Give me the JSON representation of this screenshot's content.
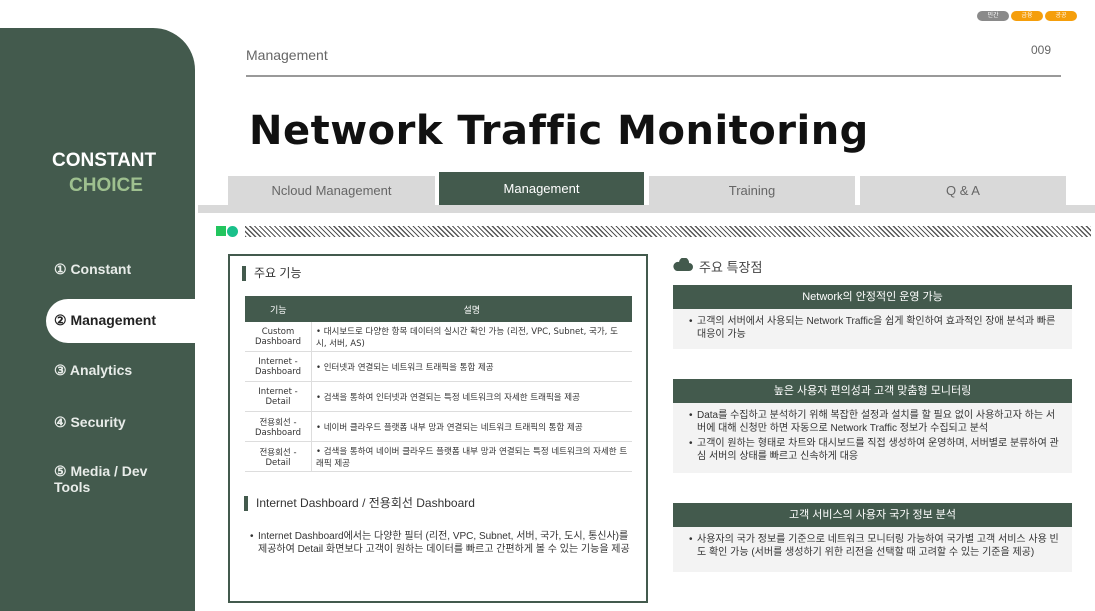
{
  "badges": [
    {
      "label": "민간",
      "color": "#8a8a8a"
    },
    {
      "label": "금융",
      "color": "#f59e0b"
    },
    {
      "label": "공공",
      "color": "#f59e0b"
    }
  ],
  "sidebar": {
    "logo_line1": "CONSTANT",
    "logo_line2": "CHOICE",
    "items": [
      {
        "label": "① Constant"
      },
      {
        "label": "② Management"
      },
      {
        "label": "③ Analytics"
      },
      {
        "label": "④ Security"
      },
      {
        "label": "⑤ Media / Dev Tools"
      }
    ]
  },
  "header": {
    "breadcrumb": "Management",
    "page_number": "009",
    "title": "Network Traffic Monitoring"
  },
  "tabs": [
    "Ncloud Management",
    "Management",
    "Training",
    "Q & A"
  ],
  "left_panel": {
    "section1_title": "주요 기능",
    "table_headers": [
      "기능",
      "설명"
    ],
    "rows": [
      {
        "key": "Custom Dashboard",
        "desc": "• 대시보드로 다양한 항목 데이터의 실시간 확인 가능 (리전, VPC, Subnet, 국가, 도시, 서버, AS)"
      },
      {
        "key": "Internet - Dashboard",
        "desc": "• 인터넷과 연결되는 네트워크 트래픽을 통합 제공"
      },
      {
        "key": "Internet - Detail",
        "desc": "• 검색을 통하여 인터넷과 연결되는 특정 네트워크의 자세한 트래픽을 제공"
      },
      {
        "key": "전용회선 - Dashboard",
        "desc": "• 네이버 클라우드 플랫폼 내부 망과 연결되는 네트워크 트래픽의 통합 제공"
      },
      {
        "key": "전용회선 - Detail",
        "desc": "• 검색을 통하여 네이버 클라우드 플랫폼 내부 망과 연결되는 특정 네트워크의 자세한 트래픽 제공"
      }
    ],
    "section2_title": "Internet Dashboard / 전용회선 Dashboard",
    "section2_text": "Internet Dashboard에서는 다양한 필터 (리전, VPC, Subnet, 서버, 국가, 도시, 통신사)를 제공하여 Detail 화면보다 고객이 원하는 데이터를 빠르고 간편하게 볼 수 있는 기능을 제공"
  },
  "right_panel": {
    "title": "주요 특장점",
    "cards": [
      {
        "heading": "Network의 안정적인 운영 가능",
        "bullets": [
          "고객의 서버에서 사용되는 Network Traffic을 쉽게 확인하여 효과적인 장애 분석과 빠른 대응이 가능"
        ]
      },
      {
        "heading": "높은 사용자 편의성과 고객 맞춤형 모니터링",
        "bullets": [
          "Data를 수집하고 분석하기 위해 복잡한 설정과 설치를 할 필요 없이 사용하고자 하는 서버에 대해 신청만 하면 자동으로 Network Traffic 정보가 수집되고 분석",
          "고객이 원하는 형태로 차트와 대시보드를 직접 생성하여 운영하며, 서버별로 분류하여 관심 서버의 상태를 빠르고 신속하게 대응"
        ]
      },
      {
        "heading": "고객 서비스의 사용자 국가 정보 분석",
        "bullets": [
          "사용자의 국가 정보를 기준으로 네트워크 모니터링 가능하여 국가별 고객 서비스 사용 빈도 확인 가능 (서버를 생성하기 위한 리전을 선택할 때 고려할 수 있는 기준을 제공)"
        ]
      }
    ]
  }
}
